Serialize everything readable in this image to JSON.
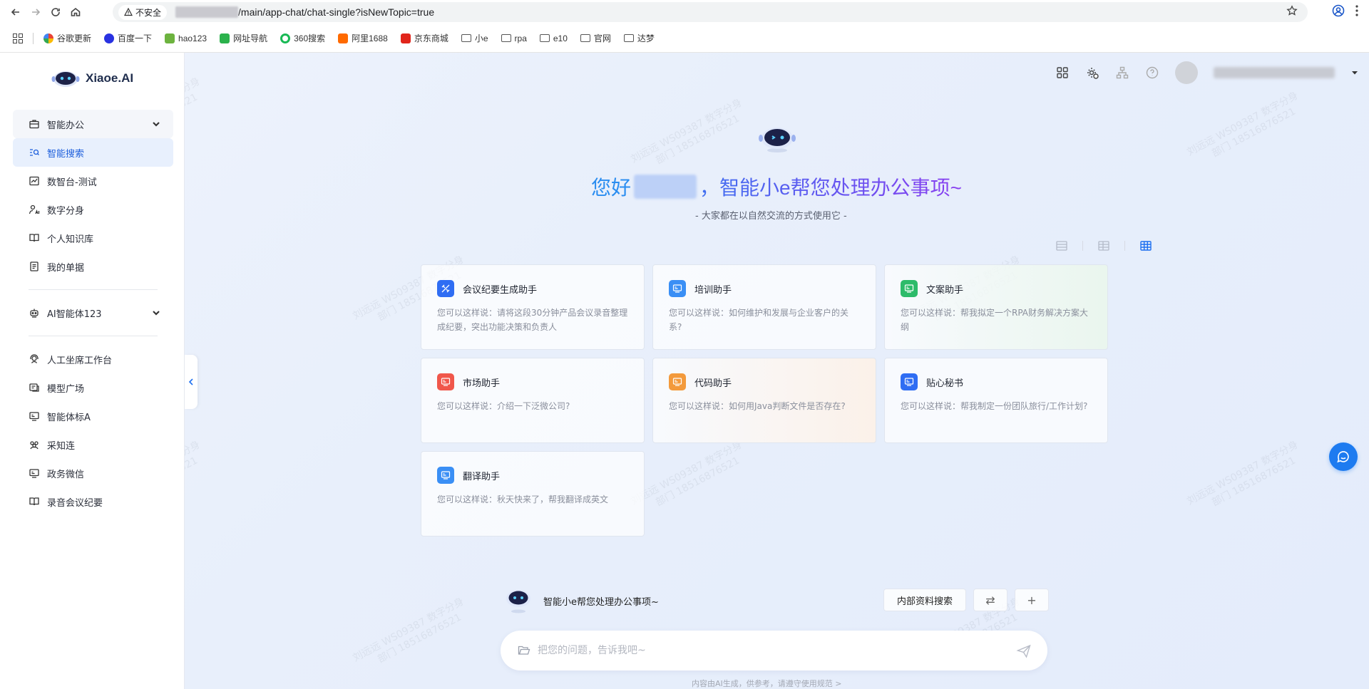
{
  "browser": {
    "insecure_label": "不安全",
    "url_path": "/main/app-chat/chat-single?isNewTopic=true",
    "bookmarks": [
      {
        "label": "谷歌更新",
        "color": "#34a853"
      },
      {
        "label": "百度一下",
        "color": "#2932e1"
      },
      {
        "label": "hao123",
        "color": "#6db33f"
      },
      {
        "label": "网址导航",
        "color": "#2bb24c"
      },
      {
        "label": "360搜索",
        "color": "#19b955"
      },
      {
        "label": "阿里1688",
        "color": "#ff6a00"
      },
      {
        "label": "京东商城",
        "color": "#e1251b"
      },
      {
        "label": "小e",
        "icon": "folder-icon"
      },
      {
        "label": "rpa",
        "icon": "folder-icon"
      },
      {
        "label": "e10",
        "icon": "folder-icon"
      },
      {
        "label": "官网",
        "icon": "folder-icon"
      },
      {
        "label": "达梦",
        "icon": "folder-icon"
      }
    ]
  },
  "app": {
    "brand": "Xiaoe.AI",
    "sidebar": {
      "group1": "智能办公",
      "items1": [
        "智能搜索",
        "数智台-测试",
        "数字分身",
        "个人知识库",
        "我的单据"
      ],
      "group2": "AI智能体123",
      "items2": [
        "人工坐席工作台",
        "模型广场",
        "智能体标A",
        "采知连",
        "政务微信",
        "录音会议纪要"
      ]
    },
    "watermark": {
      "line1": "刘远远 WS09387 数字分身",
      "line2": "部门 18516876521"
    },
    "hero": {
      "greeting": "您好",
      "greeting_tail": "，智能小e帮您处理办公事项~",
      "subtitle": "- 大家都在以自然交流的方式使用它 -"
    },
    "cards": [
      {
        "title": "会议纪要生成助手",
        "desc": "您可以这样说：请将这段30分钟产品会议录音整理成纪要，突出功能决策和负责人",
        "color": "#2f6df3"
      },
      {
        "title": "培训助手",
        "desc": "您可以这样说：如何维护和发展与企业客户的关系?",
        "color": "#3a8ff5"
      },
      {
        "title": "文案助手",
        "desc": "您可以这样说：帮我拟定一个RPA财务解决方案大纲",
        "color": "#2dbb6a"
      },
      {
        "title": "市场助手",
        "desc": "您可以这样说：介绍一下泛微公司?",
        "color": "#f0574b"
      },
      {
        "title": "代码助手",
        "desc": "您可以这样说：如何用Java判断文件是否存在?",
        "color": "#f39a3c"
      },
      {
        "title": "贴心秘书",
        "desc": "您可以这样说：帮我制定一份团队旅行/工作计划?",
        "color": "#2f6df3"
      },
      {
        "title": "翻译助手",
        "desc": "您可以这样说：秋天快来了，帮我翻译成英文",
        "color": "#3a8ff5"
      }
    ],
    "assistant_row": {
      "text": "智能小e帮您处理办公事项~",
      "search_btn": "内部资料搜索",
      "swap_icon": "⇄",
      "add_icon": "+"
    },
    "input": {
      "placeholder": "把您的问题，告诉我吧~"
    },
    "disclaimer": "内容由AI生成，供参考，请遵守使用规范 >",
    "accent": "#1d6ff0"
  }
}
